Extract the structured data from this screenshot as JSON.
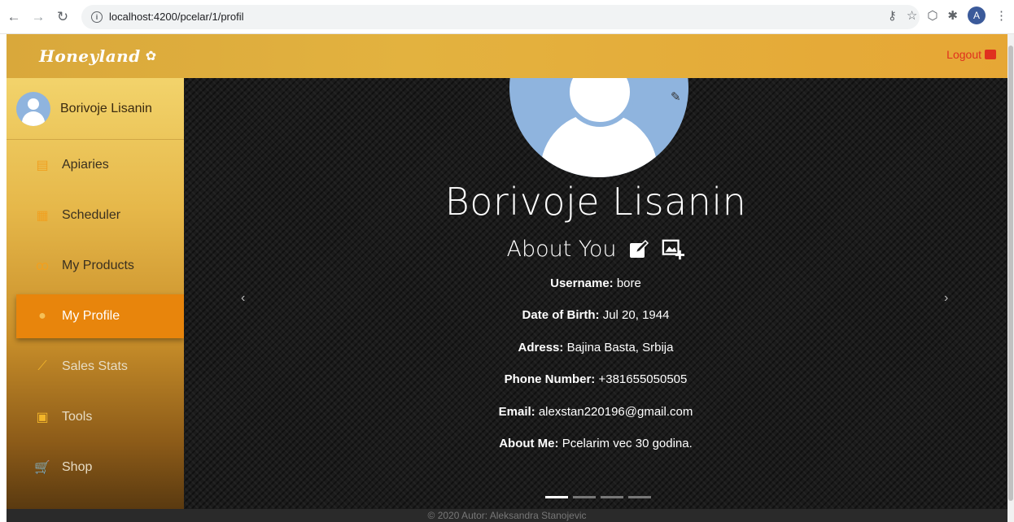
{
  "browser": {
    "url": "localhost:4200/pcelar/1/profil",
    "profile_initial": "A"
  },
  "header": {
    "logo": "Honeyland",
    "logout_label": "Logout"
  },
  "sidebar": {
    "user_name": "Borivoje Lisanin",
    "items": [
      {
        "label": "Apiaries",
        "icon": "apiary-icon"
      },
      {
        "label": "Scheduler",
        "icon": "calendar-icon"
      },
      {
        "label": "My Products",
        "icon": "bee-icon"
      },
      {
        "label": "My Profile",
        "icon": "user-icon",
        "active": true
      },
      {
        "label": "Sales Stats",
        "icon": "chart-icon"
      },
      {
        "label": "Tools",
        "icon": "calculator-icon"
      },
      {
        "label": "Shop",
        "icon": "cart-icon"
      }
    ]
  },
  "profile": {
    "name": "Borivoje Lisanin",
    "about_title": "About You",
    "fields": [
      {
        "label": "Username:",
        "value": "bore"
      },
      {
        "label": "Date of Birth:",
        "value": "Jul 20, 1944"
      },
      {
        "label": "Adress:",
        "value": "Bajina Basta, Srbija"
      },
      {
        "label": "Phone Number:",
        "value": "+381655050505"
      },
      {
        "label": "Email:",
        "value": "alexstan220196@gmail.com"
      },
      {
        "label": "About Me:",
        "value": "Pcelarim vec 30 godina."
      }
    ]
  },
  "carousel": {
    "prev": "‹",
    "next": "›",
    "active_index": 0,
    "count": 4
  },
  "footer": {
    "text": "© 2020 Autor: Aleksandra Stanojevic"
  },
  "colors": {
    "accent": "#e8850c",
    "header": "#e3b23f",
    "logout": "#e0301e",
    "avatar_bg": "#8fb4de"
  }
}
